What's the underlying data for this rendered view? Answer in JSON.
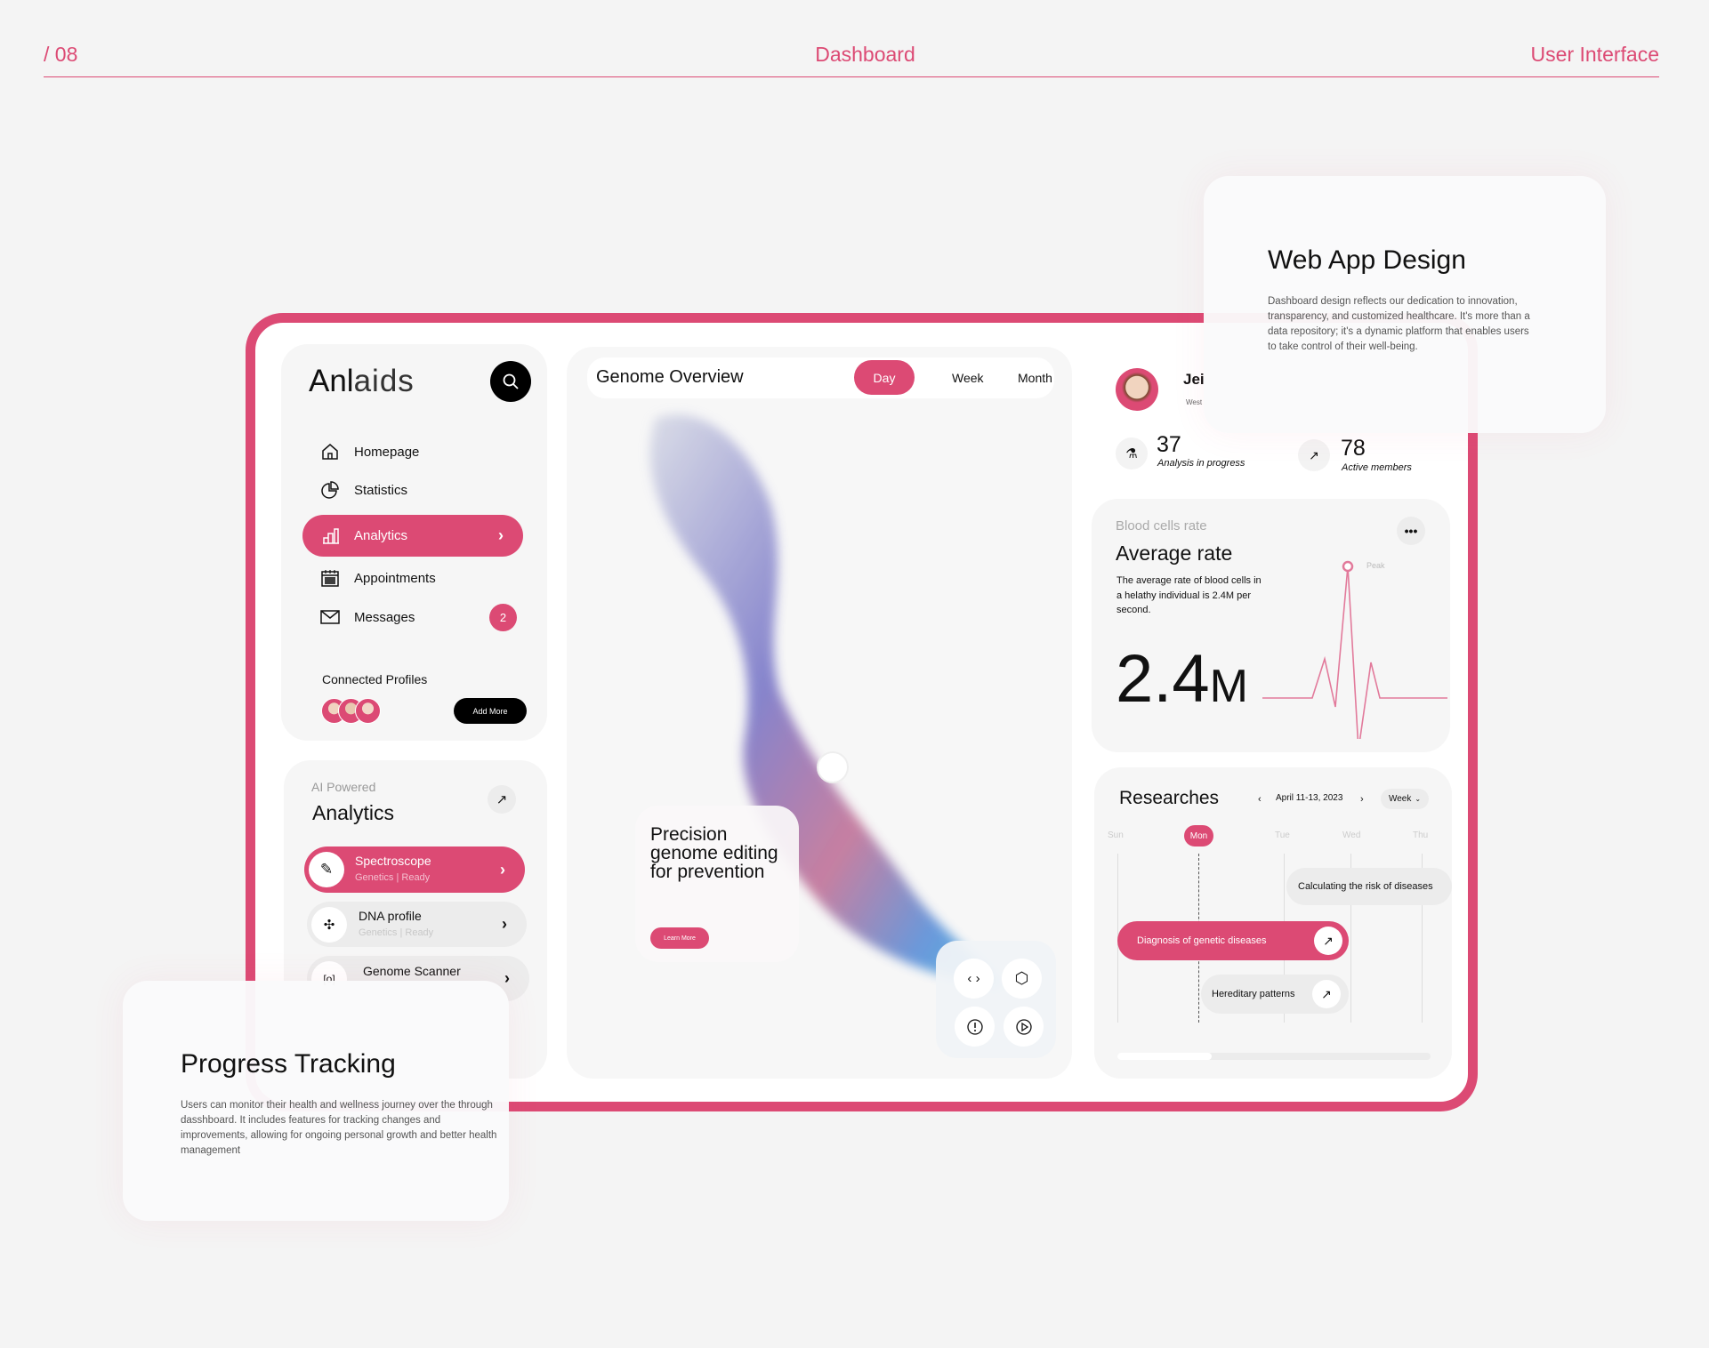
{
  "header": {
    "page_number": "/ 08",
    "center_title": "Dashboard",
    "right_title": "User Interface"
  },
  "colors": {
    "accent": "#dc4a74",
    "background": "#f4f4f4",
    "card": "#f6f6f6"
  },
  "sidebar": {
    "logo_bold": "Anl",
    "logo_light": "aids",
    "search_icon": "search-icon",
    "items": [
      {
        "label": "Homepage",
        "icon": "home-icon"
      },
      {
        "label": "Statistics",
        "icon": "pie-chart-icon"
      },
      {
        "label": "Analytics",
        "icon": "bar-chart-icon",
        "active": true
      },
      {
        "label": "Appointments",
        "icon": "calendar-icon"
      },
      {
        "label": "Messages",
        "icon": "mail-icon",
        "badge": "2"
      }
    ],
    "connected_profiles": "Connected Profiles",
    "add_more": "Add More"
  },
  "ai_analytics": {
    "eyebrow": "AI Powered",
    "title": "Analytics",
    "items": [
      {
        "title": "Spectroscope",
        "subtitle": "Genetics | Ready",
        "icon": "pipette-icon",
        "active": true
      },
      {
        "title": "DNA profile",
        "subtitle": "Genetics | Ready",
        "icon": "puzzle-icon"
      },
      {
        "title": "Genome Scanner",
        "subtitle": "",
        "icon": "scan-icon"
      }
    ]
  },
  "genome": {
    "title": "Genome Overview",
    "tabs": [
      "Day",
      "Week",
      "Month"
    ],
    "active_tab": "Day",
    "promo": {
      "title": "Precision genome editing for prevention",
      "button": "Learn More"
    },
    "controls": [
      "code-icon",
      "cube-icon",
      "alert-icon",
      "play-icon"
    ]
  },
  "profile": {
    "name": "Jei",
    "location": "West",
    "stats": [
      {
        "value": "37",
        "label": "Analysis in progress",
        "icon": "flask-icon"
      },
      {
        "value": "78",
        "label": "Active members",
        "icon": "trend-up-icon"
      }
    ]
  },
  "blood": {
    "eyebrow": "Blood cells rate",
    "title": "Average rate",
    "description": "The average rate of blood cells in a helathy individual is 2.4M per second.",
    "value": "2.4",
    "unit": "M",
    "peak_label": "Peak"
  },
  "researches": {
    "title": "Researches",
    "date_range": "April 11-13, 2023",
    "period": "Week",
    "days": [
      "Sun",
      "Mon",
      "Tue",
      "Wed",
      "Thu"
    ],
    "active_day": "Mon",
    "events": [
      {
        "label": "Calculating the risk of diseases"
      },
      {
        "label": "Diagnosis of genetic diseases",
        "highlight": true
      },
      {
        "label": "Hereditary patterns"
      }
    ],
    "scroll_progress": 0.3
  },
  "web_app_card": {
    "title": "Web App Design",
    "text": "Dashboard design reflects our dedication to innovation, transparency, and customized healthcare. It's more than a data repository; it's a dynamic platform that enables users to take control of their well-being."
  },
  "progress_card": {
    "title": "Progress Tracking",
    "text": "Users can monitor their health and wellness journey over the through dasshboard. It includes features for tracking changes and improvements, allowing for ongoing personal growth and better health management"
  }
}
